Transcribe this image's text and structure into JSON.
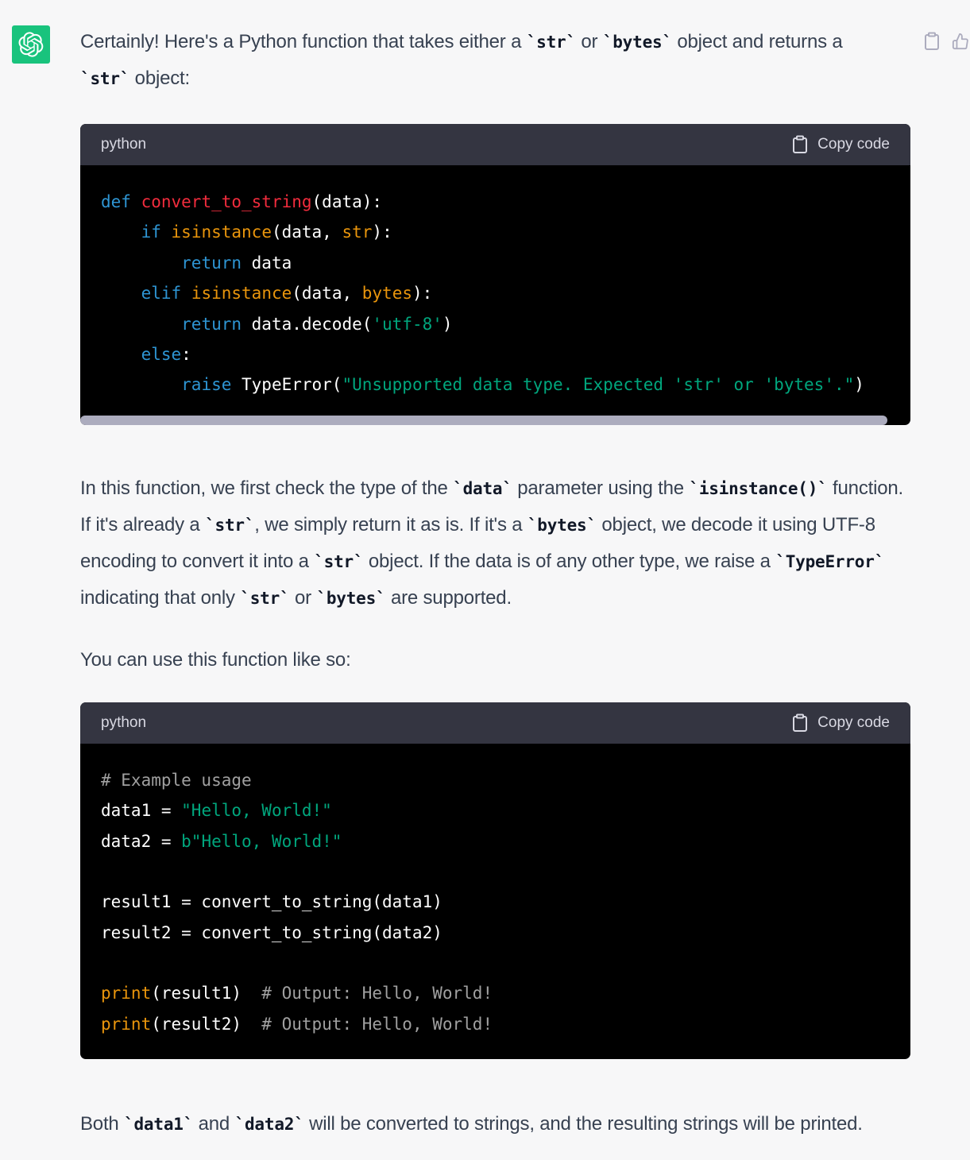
{
  "message": {
    "intro": {
      "t1": "Certainly! Here's a Python function that takes either a ",
      "c1": "`str`",
      "t2": " or ",
      "c2": "`bytes`",
      "t3": " object and returns a ",
      "c3": "`str`",
      "t4": " object:"
    },
    "code_block_1": {
      "language": "python",
      "copy_label": "Copy code",
      "lines": [
        [
          {
            "t": "def",
            "c": "kw"
          },
          {
            "t": " "
          },
          {
            "t": "convert_to_string",
            "c": "fn"
          },
          {
            "t": "(data):"
          }
        ],
        [
          {
            "t": "    "
          },
          {
            "t": "if",
            "c": "kw"
          },
          {
            "t": " "
          },
          {
            "t": "isinstance",
            "c": "bi"
          },
          {
            "t": "(data, "
          },
          {
            "t": "str",
            "c": "bi"
          },
          {
            "t": "):"
          }
        ],
        [
          {
            "t": "        "
          },
          {
            "t": "return",
            "c": "kw"
          },
          {
            "t": " data"
          }
        ],
        [
          {
            "t": "    "
          },
          {
            "t": "elif",
            "c": "kw"
          },
          {
            "t": " "
          },
          {
            "t": "isinstance",
            "c": "bi"
          },
          {
            "t": "(data, "
          },
          {
            "t": "bytes",
            "c": "bi"
          },
          {
            "t": "):"
          }
        ],
        [
          {
            "t": "        "
          },
          {
            "t": "return",
            "c": "kw"
          },
          {
            "t": " data.decode("
          },
          {
            "t": "'utf-8'",
            "c": "st"
          },
          {
            "t": ")"
          }
        ],
        [
          {
            "t": "    "
          },
          {
            "t": "else",
            "c": "kw"
          },
          {
            "t": ":"
          }
        ],
        [
          {
            "t": "        "
          },
          {
            "t": "raise",
            "c": "kw"
          },
          {
            "t": " TypeError("
          },
          {
            "t": "\"Unsupported data type. Expected 'str' or 'bytes'.\"",
            "c": "st"
          },
          {
            "t": ")"
          }
        ]
      ]
    },
    "explanation": {
      "t1": "In this function, we first check the type of the ",
      "c1": "`data`",
      "t2": " parameter using the ",
      "c2": "`isinstance()`",
      "t3": " function. If it's already a ",
      "c3": "`str`",
      "t4": ", we simply return it as is. If it's a ",
      "c4": "`bytes`",
      "t5": " object, we decode it using UTF-8 encoding to convert it into a ",
      "c5": "`str`",
      "t6": " object. If the data is of any other type, we raise a ",
      "c6": "`TypeError`",
      "t7": " indicating that only ",
      "c7": "`str`",
      "t8": " or ",
      "c8": "`bytes`",
      "t9": " are supported."
    },
    "usage_intro": "You can use this function like so:",
    "code_block_2": {
      "language": "python",
      "copy_label": "Copy code",
      "lines": [
        [
          {
            "t": "# Example usage",
            "c": "cm"
          }
        ],
        [
          {
            "t": "data1 = "
          },
          {
            "t": "\"Hello, World!\"",
            "c": "st"
          }
        ],
        [
          {
            "t": "data2 = "
          },
          {
            "t": "b\"Hello, World!\"",
            "c": "st"
          }
        ],
        [
          {
            "t": ""
          }
        ],
        [
          {
            "t": "result1 = convert_to_string(data1)"
          }
        ],
        [
          {
            "t": "result2 = convert_to_string(data2)"
          }
        ],
        [
          {
            "t": ""
          }
        ],
        [
          {
            "t": "print",
            "c": "bi"
          },
          {
            "t": "(result1)  "
          },
          {
            "t": "# Output: Hello, World!",
            "c": "cm"
          }
        ],
        [
          {
            "t": "print",
            "c": "bi"
          },
          {
            "t": "(result2)  "
          },
          {
            "t": "# Output: Hello, World!",
            "c": "cm"
          }
        ]
      ]
    },
    "conclusion": {
      "t1": "Both ",
      "c1": "`data1`",
      "t2": " and ",
      "c2": "`data2`",
      "t3": " will be converted to strings, and the resulting strings will be printed."
    }
  },
  "icons": {
    "avatar": "openai-logo-icon",
    "copy_message": "clipboard-icon",
    "thumbs_up": "thumbs-up-icon",
    "copy_code": "clipboard-icon"
  },
  "colors": {
    "avatar_bg": "#19c37d",
    "page_bg": "#f7f7f8",
    "code_bg": "#000000",
    "code_header_bg": "#343541",
    "keyword": "#2e95d3",
    "function_name": "#f22c3d",
    "builtin": "#e9950c",
    "string": "#00a67d",
    "comment": "#a0a0a0"
  }
}
